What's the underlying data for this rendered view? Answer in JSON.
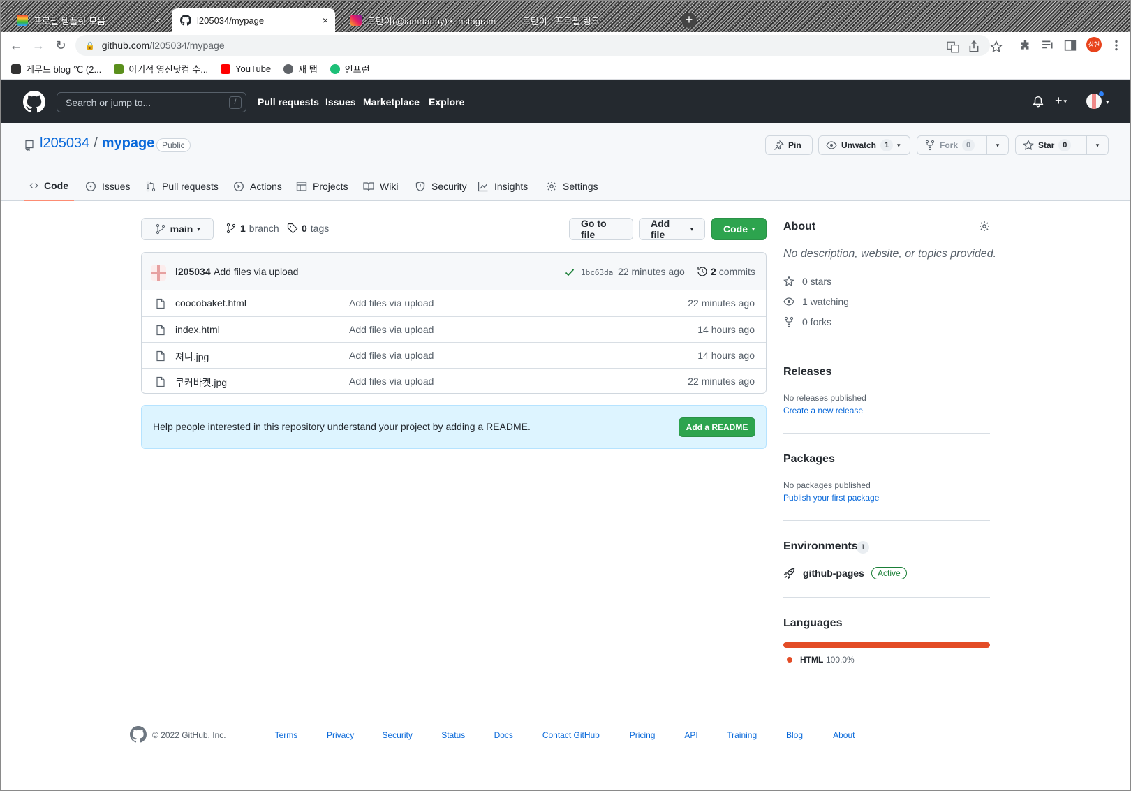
{
  "browser": {
    "tabs": [
      {
        "title": "프로필 템플릿 모음",
        "active": false
      },
      {
        "title": "l205034/mypage",
        "active": true
      },
      {
        "title": "트탄이(@iamrtanny) • Instagram",
        "active": false
      },
      {
        "title": "트탄이 - 프로필 링크",
        "active": false
      }
    ],
    "new_tab": "+",
    "close_glyph": "×",
    "url_host": "github.com",
    "url_path": "/l205034/mypage",
    "profile_initials": "상현",
    "bookmarks": [
      {
        "label": "게무드 blog ℃ (2...",
        "color": "#333333"
      },
      {
        "label": "이기적 영진닷컴 수...",
        "color": "#5a8f1c"
      },
      {
        "label": "YouTube",
        "color": "#ff0000"
      },
      {
        "label": "새 탭",
        "color": "#5f6368"
      },
      {
        "label": "인프런",
        "color": "#1dc078"
      }
    ]
  },
  "github": {
    "search_placeholder": "Search or jump to...",
    "search_key": "/",
    "nav": [
      "Pull requests",
      "Issues",
      "Marketplace",
      "Explore"
    ],
    "plus": "+",
    "caret": "▾"
  },
  "repo": {
    "owner": "l205034",
    "separator": "/",
    "name": "mypage",
    "visibility": "Public",
    "actions": {
      "pin": "Pin",
      "watch": "Unwatch",
      "watch_count": "1",
      "fork": "Fork",
      "fork_count": "0",
      "star": "Star",
      "star_count": "0"
    },
    "tabs": [
      {
        "label": "Code",
        "icon": "code-icon",
        "selected": true
      },
      {
        "label": "Issues",
        "icon": "issue-icon",
        "selected": false
      },
      {
        "label": "Pull requests",
        "icon": "pull-request-icon",
        "selected": false
      },
      {
        "label": "Actions",
        "icon": "play-icon",
        "selected": false
      },
      {
        "label": "Projects",
        "icon": "table-icon",
        "selected": false
      },
      {
        "label": "Wiki",
        "icon": "book-icon",
        "selected": false
      },
      {
        "label": "Security",
        "icon": "shield-icon",
        "selected": false
      },
      {
        "label": "Insights",
        "icon": "graph-icon",
        "selected": false
      },
      {
        "label": "Settings",
        "icon": "gear-icon",
        "selected": false
      }
    ]
  },
  "code": {
    "branch": "main",
    "branch_count": "1",
    "branch_label": "branch",
    "tag_count": "0",
    "tag_label": "tags",
    "go_to_file": "Go to file",
    "add_file": "Add file",
    "code_button": "Code",
    "commit": {
      "author": "l205034",
      "message": "Add files via upload",
      "sha": "1bc63da",
      "age": "22 minutes ago",
      "count": "2",
      "count_label": "commits"
    },
    "files": [
      {
        "name": "coocobaket.html",
        "message": "Add files via upload",
        "age": "22 minutes ago"
      },
      {
        "name": "index.html",
        "message": "Add files via upload",
        "age": "14 hours ago"
      },
      {
        "name": "져니.jpg",
        "message": "Add files via upload",
        "age": "14 hours ago"
      },
      {
        "name": "쿠커바켓.jpg",
        "message": "Add files via upload",
        "age": "22 minutes ago"
      }
    ],
    "readme_prompt": "Help people interested in this repository understand your project by adding a README.",
    "readme_button": "Add a README"
  },
  "sidebar": {
    "about_title": "About",
    "about_desc": "No description, website, or topics provided.",
    "stars": "0 stars",
    "watching": "1 watching",
    "forks": "0 forks",
    "releases_title": "Releases",
    "releases_note": "No releases published",
    "releases_link": "Create a new release",
    "packages_title": "Packages",
    "packages_note": "No packages published",
    "packages_link": "Publish your first package",
    "environments_title": "Environments",
    "environments_count": "1",
    "environment_name": "github-pages",
    "environment_status": "Active",
    "languages_title": "Languages",
    "language_name": "HTML",
    "language_pct": "100.0%",
    "language_color": "#e34c26"
  },
  "footer": {
    "copyright": "© 2022 GitHub, Inc.",
    "links": [
      "Terms",
      "Privacy",
      "Security",
      "Status",
      "Docs",
      "Contact GitHub",
      "Pricing",
      "API",
      "Training",
      "Blog",
      "About"
    ]
  },
  "colors": {
    "header_bg": "#24292f",
    "link": "#0969da",
    "green_button": "#2da44e",
    "tab_underline": "#fd8c73"
  }
}
